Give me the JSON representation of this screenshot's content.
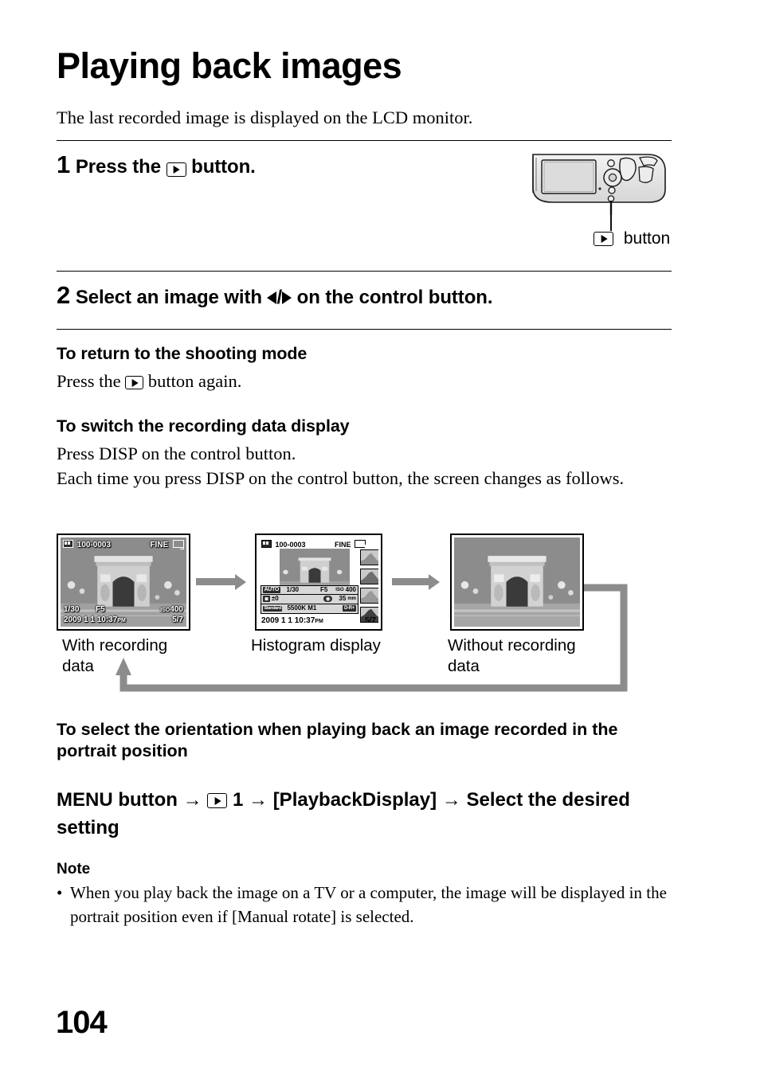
{
  "page": {
    "number": "104",
    "title": "Playing back images",
    "intro": "The last recorded image is displayed on the LCD monitor."
  },
  "steps": [
    {
      "number": "1",
      "text_before": "Press the",
      "icon": "playback-icon",
      "text_after": "button."
    },
    {
      "number": "2",
      "text_before": "Select an image with",
      "icon": "left-right-triangles",
      "text_after": "on the control button."
    }
  ],
  "camera_figure": {
    "icon": "playback-icon",
    "caption": "button"
  },
  "sections": [
    {
      "heading": "To return to the shooting mode",
      "body_before": "Press the",
      "icon": "playback-icon",
      "body_after": "button again."
    },
    {
      "heading": "To switch the recording data display",
      "line1": "Press DISP on the control button.",
      "line2": "Each time you press DISP on the control button, the screen changes as follows."
    }
  ],
  "flow": {
    "screens": [
      {
        "caption": "With recording data",
        "header": {
          "card_icon": "memory-card-icon",
          "folder_file": "100-0003",
          "quality": "FINE",
          "size_icon": "image-size-icon"
        },
        "footer_row1": {
          "shutter": "1/30",
          "aperture": "F5",
          "iso_label": "ISO",
          "iso_value": "400"
        },
        "footer_row2": {
          "date": "2009  1  1",
          "time": "10:37",
          "ampm": "PM",
          "index": "5/7"
        }
      },
      {
        "caption": "Histogram display",
        "header": {
          "card_icon": "memory-card-icon",
          "folder_file": "100-0003",
          "quality": "FINE",
          "size_icon": "image-size-icon"
        },
        "data_rows": [
          {
            "mode": "AUTO",
            "shutter": "1/30",
            "aperture": "F5",
            "iso_label": "ISO",
            "iso_value": "400"
          },
          {
            "ev_icon": "exposure-comp-icon",
            "ev": "±0",
            "metering_icon": "metering-icon",
            "focal": "35",
            "focal_unit": "mm"
          },
          {
            "creative_style": "Standard",
            "white_balance": "5500K M1",
            "dro_icon": "D-R+"
          }
        ],
        "footer": {
          "date": "2009  1  1",
          "time": "10:37",
          "ampm": "PM",
          "index": "5/7"
        },
        "histograms": [
          "luminance",
          "red",
          "green",
          "blue"
        ]
      },
      {
        "caption": "Without recording data"
      }
    ],
    "arrow_icon": "right-arrow-icon",
    "loop_arrow_icon": "loop-back-arrow-icon"
  },
  "orientation_section": {
    "heading": "To select the orientation when playing back an image recorded in the portrait position",
    "menu_path": {
      "part1": "MENU button",
      "arrow": "→",
      "icon": "playback-icon",
      "part2": "1",
      "part3": "[PlaybackDisplay]",
      "part4": "Select the desired setting"
    }
  },
  "note": {
    "heading": "Note",
    "bullet": "•",
    "text": "When you play back the image on a TV or a computer, the image will be displayed in the portrait position even if [Manual rotate] is selected."
  }
}
